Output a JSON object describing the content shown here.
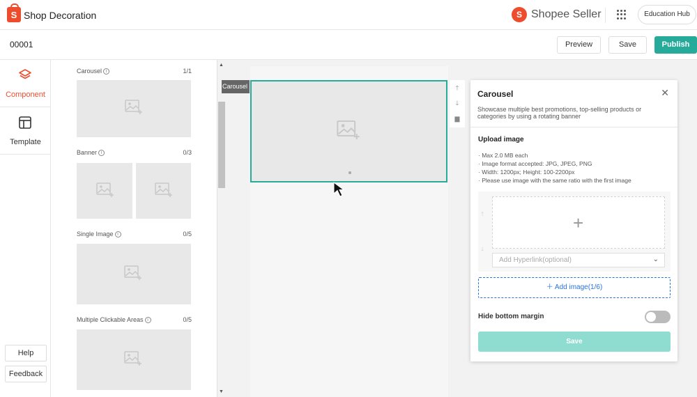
{
  "topbar": {
    "app_title": "Shop Decoration",
    "seller_brand": "Shopee Seller",
    "education_hub": "Education Hub"
  },
  "subbar": {
    "page_id": "00001",
    "preview": "Preview",
    "save": "Save",
    "publish": "Publish"
  },
  "leftnav": {
    "component": "Component",
    "template": "Template",
    "help": "Help",
    "feedback": "Feedback"
  },
  "components": [
    {
      "title": "Carousel",
      "count": "1/1"
    },
    {
      "title": "Banner",
      "count": "0/3"
    },
    {
      "title": "Single Image",
      "count": "0/5"
    },
    {
      "title": "Multiple Clickable Areas",
      "count": "0/5"
    }
  ],
  "canvas": {
    "carousel_tag": "Carousel"
  },
  "props": {
    "title": "Carousel",
    "description": "Showcase multiple best promotions, top-selling products or categories by using a rotating banner",
    "upload_title": "Upload image",
    "rules": [
      "Max 2.0 MB each",
      "Image format accepted: JPG, JPEG, PNG",
      "Width: 1200px; Height: 100-2200px",
      "Please use image with the same ratio with the first image"
    ],
    "hyperlink_placeholder": "Add Hyperlink(optional)",
    "add_image": "Add image(1/6)",
    "hide_bottom_margin": "Hide bottom margin",
    "hide_bottom_margin_on": false,
    "save": "Save"
  },
  "colors": {
    "brand": "#ee4d2d",
    "primary": "#26aa99",
    "link": "#2673dd"
  }
}
